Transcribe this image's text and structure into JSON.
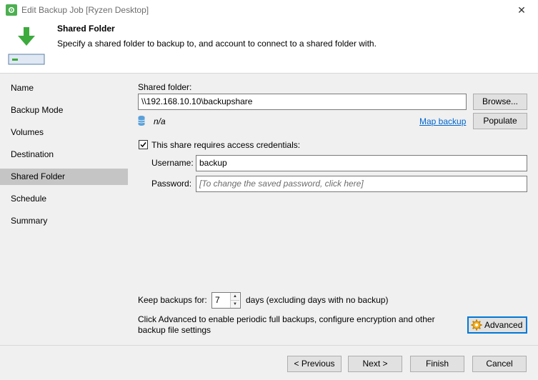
{
  "window": {
    "title": "Edit Backup Job [Ryzen Desktop]",
    "close_glyph": "✕"
  },
  "header": {
    "title": "Shared Folder",
    "description": "Specify a shared folder to backup to, and account to connect to a shared folder with.",
    "icon": "download-to-drive-icon"
  },
  "nav": {
    "items": [
      {
        "label": "Name",
        "active": false
      },
      {
        "label": "Backup Mode",
        "active": false
      },
      {
        "label": "Volumes",
        "active": false
      },
      {
        "label": "Destination",
        "active": false
      },
      {
        "label": "Shared Folder",
        "active": true
      },
      {
        "label": "Schedule",
        "active": false
      },
      {
        "label": "Summary",
        "active": false
      }
    ]
  },
  "main": {
    "shared_folder_label": "Shared folder:",
    "shared_folder_value": "\\\\192.168.10.10\\backupshare",
    "browse_label": "Browse...",
    "size_value": "n/a",
    "map_backup_label": "Map backup",
    "populate_label": "Populate",
    "credentials_label": "This share requires access credentials:",
    "credentials_checked": true,
    "username_label": "Username:",
    "username_value": "backup",
    "password_label": "Password:",
    "password_placeholder": "[To change the saved password, click here]",
    "keep_label": "Keep backups for:",
    "keep_value": "7",
    "keep_suffix": "days (excluding days with no backup)",
    "advanced_hint": "Click Advanced to enable periodic full backups, configure encryption and other backup file settings",
    "advanced_label": "Advanced"
  },
  "footer": {
    "previous_label": "< Previous",
    "next_label": "Next >",
    "finish_label": "Finish",
    "cancel_label": "Cancel"
  },
  "colors": {
    "accent": "#4caf50",
    "link": "#0066cc",
    "selected_nav": "#c5c5c5",
    "focus_border": "#0078d7"
  }
}
